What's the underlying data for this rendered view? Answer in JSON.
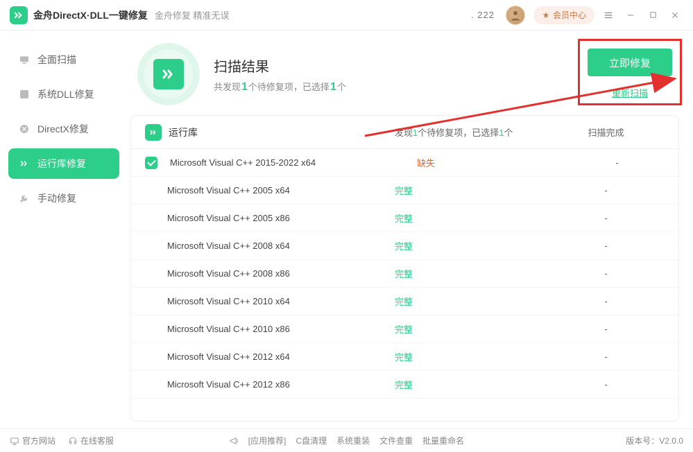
{
  "titlebar": {
    "main": "金舟DirectX·DLL一键修复",
    "sub": "金舟修复 精准无误",
    "points": ". 222",
    "vip": "会员中心"
  },
  "sidebar": {
    "items": [
      {
        "label": "全面扫描"
      },
      {
        "label": "系统DLL修复"
      },
      {
        "label": "DirectX修复"
      },
      {
        "label": "运行库修复"
      },
      {
        "label": "手动修复"
      }
    ]
  },
  "result": {
    "title": "扫描结果",
    "sub_prefix": "共发现",
    "sub_mid": "个待修复项，已选择",
    "sub_suffix": "个",
    "found": "1",
    "selected": "1",
    "repair_btn": "立即修复",
    "rescan": "重新扫描"
  },
  "table": {
    "head_name": "运行库",
    "head_status_pre": "发现",
    "head_status_mid": "个待修复项，已选择",
    "head_status_suf": "个",
    "head_found": "1",
    "head_selected": "1",
    "head_prog": "扫描完成",
    "rows": [
      {
        "name": "Microsoft Visual C++ 2015-2022 x64",
        "status": "缺失",
        "ok": false,
        "chk": true
      },
      {
        "name": "Microsoft Visual C++ 2005 x64",
        "status": "完整",
        "ok": true,
        "chk": false
      },
      {
        "name": "Microsoft Visual C++ 2005 x86",
        "status": "完整",
        "ok": true,
        "chk": false
      },
      {
        "name": "Microsoft Visual C++ 2008 x64",
        "status": "完整",
        "ok": true,
        "chk": false
      },
      {
        "name": "Microsoft Visual C++ 2008 x86",
        "status": "完整",
        "ok": true,
        "chk": false
      },
      {
        "name": "Microsoft Visual C++ 2010 x64",
        "status": "完整",
        "ok": true,
        "chk": false
      },
      {
        "name": "Microsoft Visual C++ 2010 x86",
        "status": "完整",
        "ok": true,
        "chk": false
      },
      {
        "name": "Microsoft Visual C++ 2012 x64",
        "status": "完整",
        "ok": true,
        "chk": false
      },
      {
        "name": "Microsoft Visual C++ 2012 x86",
        "status": "完整",
        "ok": true,
        "chk": false
      }
    ]
  },
  "footer": {
    "site": "官方网站",
    "support": "在线客服",
    "app_rec": "[应用推荐]",
    "c_clean": "C盘清理",
    "reinstall": "系统重装",
    "dup": "文件查重",
    "rename": "批量重命名",
    "version": "版本号：V2.0.0"
  }
}
